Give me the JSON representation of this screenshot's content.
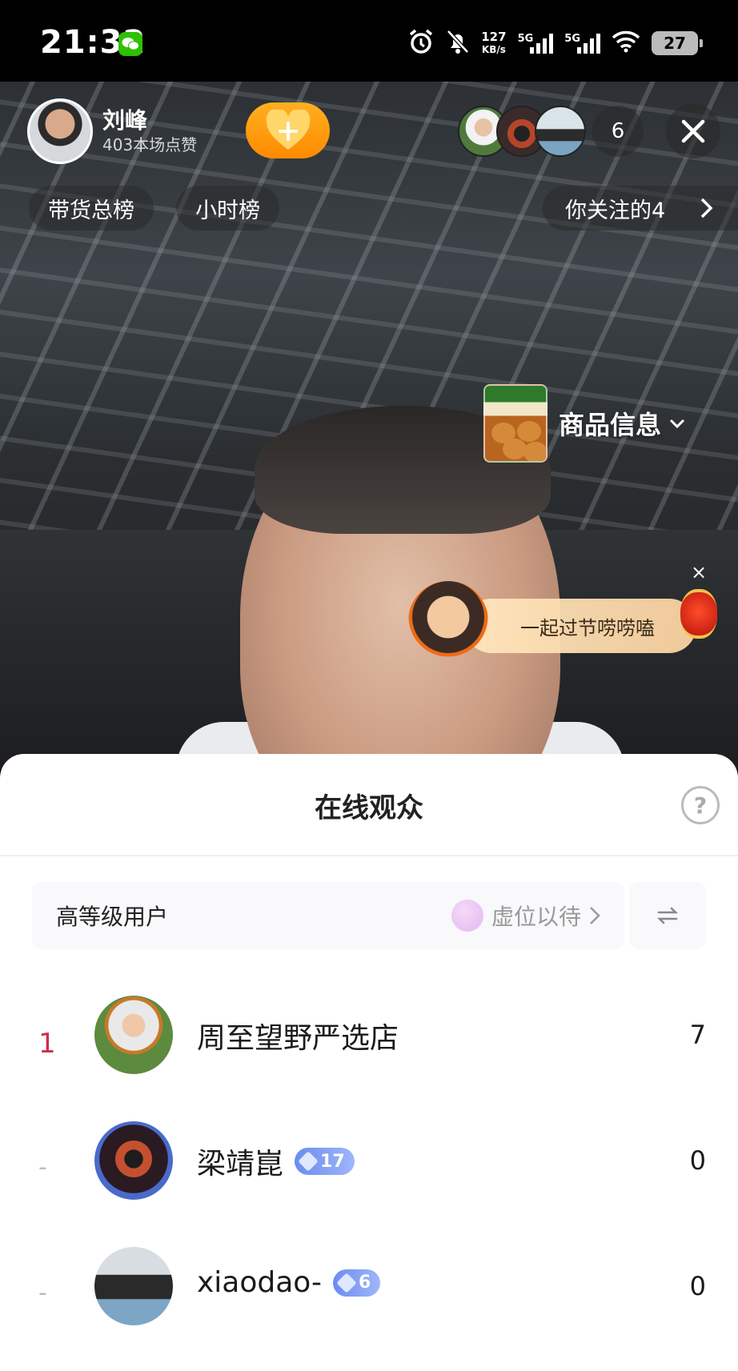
{
  "status_bar": {
    "time": "21:32",
    "net_speed_value": "127",
    "net_speed_unit": "KB/s",
    "sim1": "5G",
    "sim2": "5G",
    "battery": "27"
  },
  "live": {
    "anchor_name": "刘峰",
    "anchor_likes": "403本场点赞",
    "viewer_count": "6",
    "chips": {
      "sales_rank": "带货总榜",
      "hourly_rank": "小时榜",
      "following": "你关注的4"
    },
    "product_label": "商品信息",
    "festival_text": "一起过节唠唠嗑"
  },
  "sheet": {
    "title": "在线观众",
    "high_level_label": "高等级用户",
    "vacant_label": "虚位以待",
    "rows": [
      {
        "rank": "1",
        "name": "周至望野严选店",
        "badge": "",
        "score": "7"
      },
      {
        "rank": "-",
        "name": "梁靖崑",
        "badge": "17",
        "score": "0"
      },
      {
        "rank": "-",
        "name": "xiaodao-",
        "badge": "6",
        "score": "0"
      }
    ]
  },
  "colors": {
    "accent_rank": "#d22a4b",
    "follow_btn": "#ff9a0c",
    "badge_blue": "#7d9bf3",
    "wechat_green": "#2dc100"
  },
  "icons": [
    "wechat-icon",
    "alarm-icon",
    "mute-icon",
    "signal-icon",
    "wifi-icon",
    "battery-icon",
    "heart-plus-icon",
    "close-icon",
    "chevron-right-icon",
    "chevron-down-icon",
    "help-icon",
    "swap-icon",
    "diamond-icon"
  ]
}
